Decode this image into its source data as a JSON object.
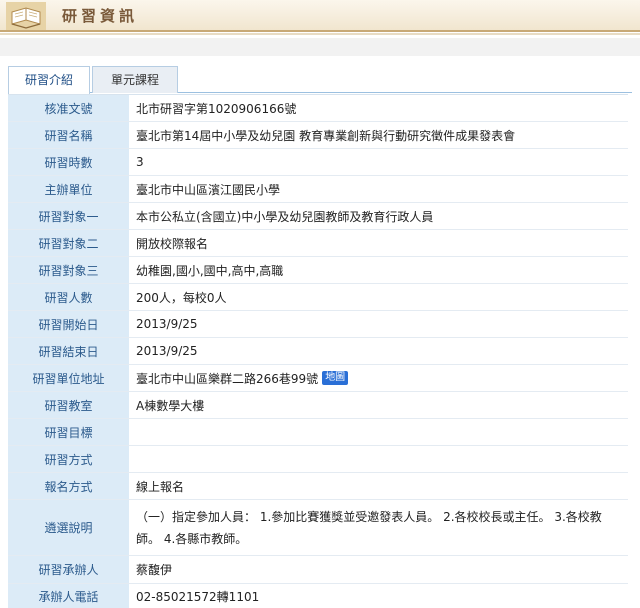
{
  "header": {
    "title": "研習資訊",
    "icon": "book-icon"
  },
  "tabs": [
    {
      "label": "研習介紹",
      "active": true
    },
    {
      "label": "單元課程",
      "active": false
    }
  ],
  "rows": [
    {
      "label": "核准文號",
      "value": "北市研習字第1020906166號"
    },
    {
      "label": "研習名稱",
      "value": "臺北市第14屆中小學及幼兒園 教育專業創新與行動研究徵件成果發表會"
    },
    {
      "label": "研習時數",
      "value": "3"
    },
    {
      "label": "主辦單位",
      "value": "臺北市中山區濱江國民小學"
    },
    {
      "label": "研習對象一",
      "value": "本市公私立(含國立)中小學及幼兒園教師及教育行政人員"
    },
    {
      "label": "研習對象二",
      "value": "開放校際報名"
    },
    {
      "label": "研習對象三",
      "value": "幼稚園,國小,國中,高中,高職"
    },
    {
      "label": "研習人數",
      "value": "200人，每校0人"
    },
    {
      "label": "研習開始日",
      "value": "2013/9/25"
    },
    {
      "label": "研習結束日",
      "value": "2013/9/25"
    },
    {
      "label": "研習單位地址",
      "value": "臺北市中山區樂群二路266巷99號",
      "badge": "地圖"
    },
    {
      "label": "研習教室",
      "value": "A棟數學大樓"
    },
    {
      "label": "研習目標",
      "value": ""
    },
    {
      "label": "研習方式",
      "value": ""
    },
    {
      "label": "報名方式",
      "value": "線上報名"
    },
    {
      "label": "遴選說明",
      "value": "（一）指定參加人員： 1.參加比賽獲獎並受邀發表人員。 2.各校校長或主任。 3.各校教師。 4.各縣市教師。"
    },
    {
      "label": "研習承辦人",
      "value": "蔡馥伊"
    },
    {
      "label": "承辦人電話",
      "value": "02-85021572轉1101"
    }
  ]
}
